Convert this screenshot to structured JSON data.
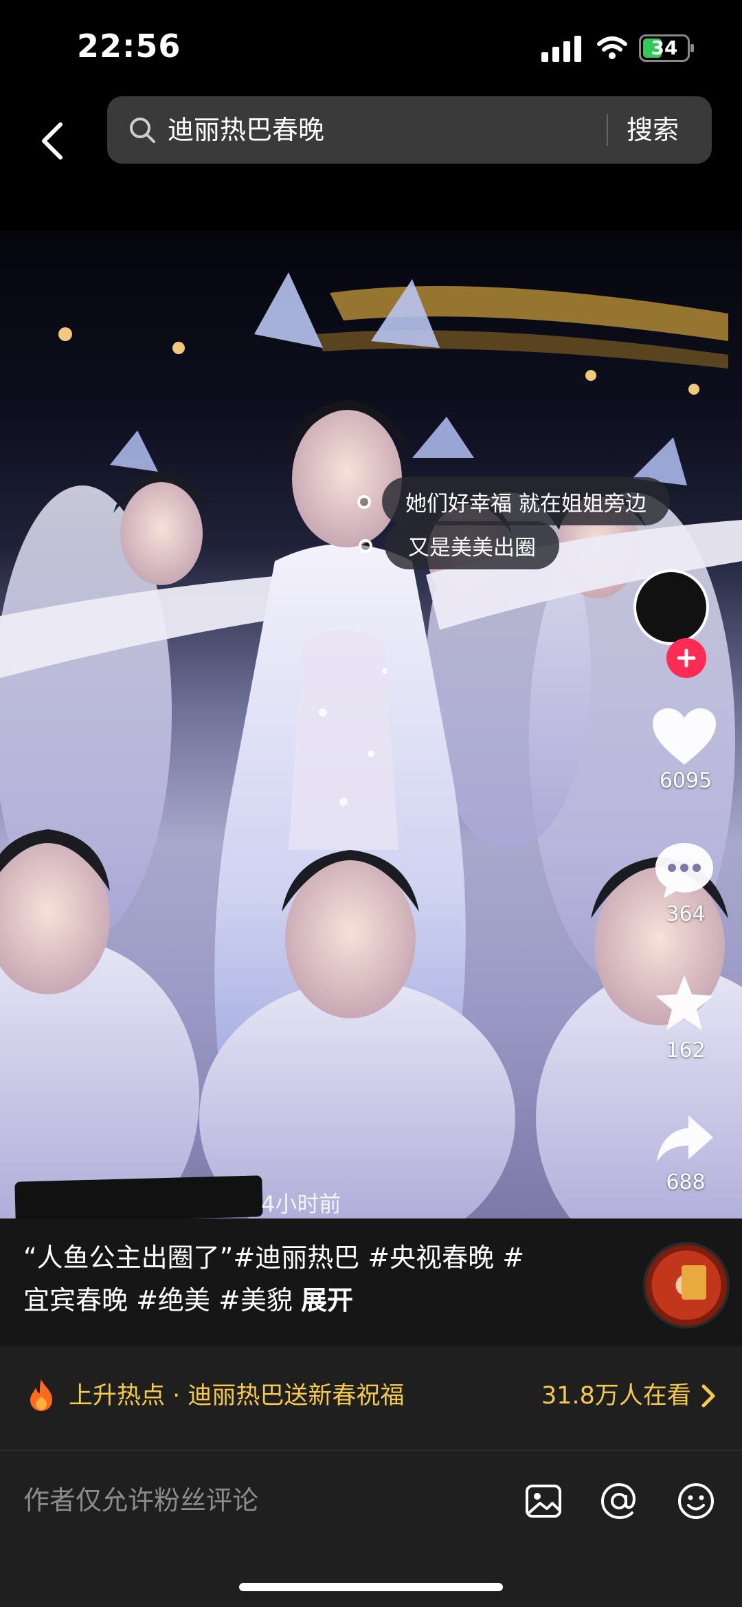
{
  "status_bar": {
    "time": "22:56",
    "battery_level": "34"
  },
  "search": {
    "query": "迪丽热巴春晚",
    "button_label": "搜索"
  },
  "video": {
    "danmaku": [
      {
        "text": "她们好幸福 就在姐姐旁边"
      },
      {
        "text": "又是美美出圈"
      }
    ],
    "timestamp": "4小时前",
    "likes": "6095",
    "comments": "364",
    "favorites": "162",
    "shares": "688"
  },
  "caption": {
    "text": "“人鱼公主出圈了”",
    "tags_line1": "#迪丽热巴 #央视春晚 #",
    "tags_line2": "宜宾春晚 #绝美 #美貌",
    "expand": "展开",
    "progress": [
      0.5,
      0.0
    ]
  },
  "hot_topic": {
    "label": "上升热点 · 迪丽热巴送新春祝福",
    "viewers": "31.8万人在看"
  },
  "comment_bar": {
    "placeholder": "作者仅允许粉丝评论"
  },
  "colors": {
    "accent_yellow": "#f6c94b",
    "follow_red": "#fe2c55",
    "battery_green": "#34c759"
  }
}
